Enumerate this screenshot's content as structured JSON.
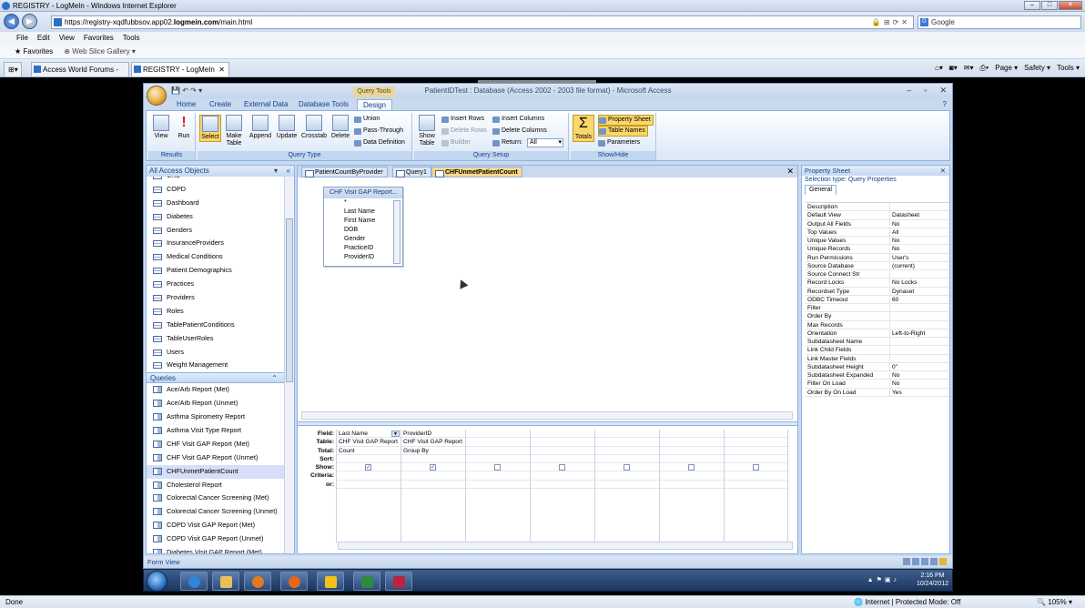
{
  "ie": {
    "title": "REGISTRY - LogMeIn - Windows Internet Explorer",
    "url_prefix": "https://registry-xqdfubbsov.app02.",
    "url_bold": "logmein.com",
    "url_suffix": "/main.html",
    "search_placeholder": "Google",
    "menu": [
      "File",
      "Edit",
      "View",
      "Favorites",
      "Tools"
    ],
    "favorites_label": "Favorites",
    "web_slice_label": "Web Slice Gallery ▾",
    "tabs": [
      "Access World Forums - Re...",
      "REGISTRY - LogMeIn"
    ],
    "commands": [
      "Page ▾",
      "Safety ▾",
      "Tools ▾"
    ],
    "status_left": "Done",
    "status_zone": "Internet | Protected Mode: Off",
    "status_zoom": "105%"
  },
  "access": {
    "title": "PatientIDTest : Database (Access 2002 - 2003 file format) - Microsoft Access",
    "query_tools_label": "Query Tools",
    "ribbon_tabs": [
      "Home",
      "Create",
      "External Data",
      "Database Tools",
      "Design"
    ],
    "active_ribbon_tab": "Design",
    "groups": {
      "results": {
        "label": "Results",
        "view": "View",
        "run": "Run"
      },
      "query_type": {
        "label": "Query Type",
        "select": "Select",
        "make_table": "Make Table",
        "append": "Append",
        "update": "Update",
        "crosstab": "Crosstab",
        "delete": "Delete",
        "union": "Union",
        "pass_through": "Pass-Through",
        "data_definition": "Data Definition"
      },
      "query_setup": {
        "label": "Query Setup",
        "show_table": "Show Table",
        "insert_rows": "Insert Rows",
        "delete_rows": "Delete Rows",
        "builder": "Builder",
        "insert_columns": "Insert Columns",
        "delete_columns": "Delete Columns",
        "return_label": "Return:",
        "return_value": "All"
      },
      "show_hide": {
        "label": "Show/Hide",
        "totals": "Totals",
        "property_sheet": "Property Sheet",
        "table_names": "Table Names",
        "parameters": "Parameters"
      }
    },
    "nav": {
      "header": "All Access Objects",
      "tables": [
        "CKD",
        "COPD",
        "Dashboard",
        "Diabetes",
        "Genders",
        "InsuranceProviders",
        "Medical Conditions",
        "Patient Demographics",
        "Practices",
        "Providers",
        "Roles",
        "TablePatientConditions",
        "TableUserRoles",
        "Users",
        "Weight Management"
      ],
      "queries_header": "Queries",
      "queries": [
        "Ace/Arb Report (Met)",
        "Ace/Arb Report (Unmet)",
        "Asthma Spirometry Report",
        "Asthma Visit Type Report",
        "CHF Visit GAP Report (Met)",
        "CHF Visit GAP Report (Unmet)",
        "CHFUnmetPatientCount",
        "Cholesterol Report",
        "Colorectal Cancer Screening (Met)",
        "Colorectal Cancer Screening (Unmet)",
        "COPD Visit GAP Report (Met)",
        "COPD Visit GAP Report (Unmet)",
        "Diabetes Visit GAP Report (Met)"
      ],
      "selected_query": "CHFUnmetPatientCount"
    },
    "doc_tabs": [
      "PatientCountByProvider",
      "Query1",
      "CHFUnmetPatientCount"
    ],
    "active_doc_tab": "CHFUnmetPatientCount",
    "table_box": {
      "title": "CHF Visit GAP Report...",
      "fields": [
        "*",
        "Last Name",
        "First Name",
        "DOB",
        "Gender",
        "PracticeID",
        "ProviderID"
      ]
    },
    "grid": {
      "row_labels": [
        "Field:",
        "Table:",
        "Total:",
        "Sort:",
        "Show:",
        "Criteria:",
        "or:"
      ],
      "columns": [
        {
          "field": "Last Name",
          "table": "CHF Visit GAP Report",
          "total": "Count",
          "sort": "",
          "show": true
        },
        {
          "field": "ProviderID",
          "table": "CHF Visit GAP Report",
          "total": "Group By",
          "sort": "",
          "show": true
        },
        {
          "field": "",
          "table": "",
          "total": "",
          "sort": "",
          "show": false
        },
        {
          "field": "",
          "table": "",
          "total": "",
          "sort": "",
          "show": false
        },
        {
          "field": "",
          "table": "",
          "total": "",
          "sort": "",
          "show": false
        },
        {
          "field": "",
          "table": "",
          "total": "",
          "sort": "",
          "show": false
        },
        {
          "field": "",
          "table": "",
          "total": "",
          "sort": "",
          "show": false
        }
      ]
    },
    "property_sheet": {
      "title": "Property Sheet",
      "selection_type": "Selection type:  Query Properties",
      "tab": "General",
      "rows": [
        [
          "Description",
          ""
        ],
        [
          "Default View",
          "Datasheet"
        ],
        [
          "Output All Fields",
          "No"
        ],
        [
          "Top Values",
          "All"
        ],
        [
          "Unique Values",
          "No"
        ],
        [
          "Unique Records",
          "No"
        ],
        [
          "Run Permissions",
          "User's"
        ],
        [
          "Source Database",
          "(current)"
        ],
        [
          "Source Connect Str",
          ""
        ],
        [
          "Record Locks",
          "No Locks"
        ],
        [
          "Recordset Type",
          "Dynaset"
        ],
        [
          "ODBC Timeout",
          "60"
        ],
        [
          "Filter",
          ""
        ],
        [
          "Order By",
          ""
        ],
        [
          "Max Records",
          ""
        ],
        [
          "Orientation",
          "Left-to-Right"
        ],
        [
          "Subdatasheet Name",
          ""
        ],
        [
          "Link Child Fields",
          ""
        ],
        [
          "Link Master Fields",
          ""
        ],
        [
          "Subdatasheet Height",
          "0\""
        ],
        [
          "Subdatasheet Expanded",
          "No"
        ],
        [
          "Filter On Load",
          "No"
        ],
        [
          "Order By On Load",
          "Yes"
        ]
      ]
    },
    "status": "Form View"
  },
  "taskbar": {
    "time": "2:16 PM",
    "date": "10/24/2012"
  }
}
